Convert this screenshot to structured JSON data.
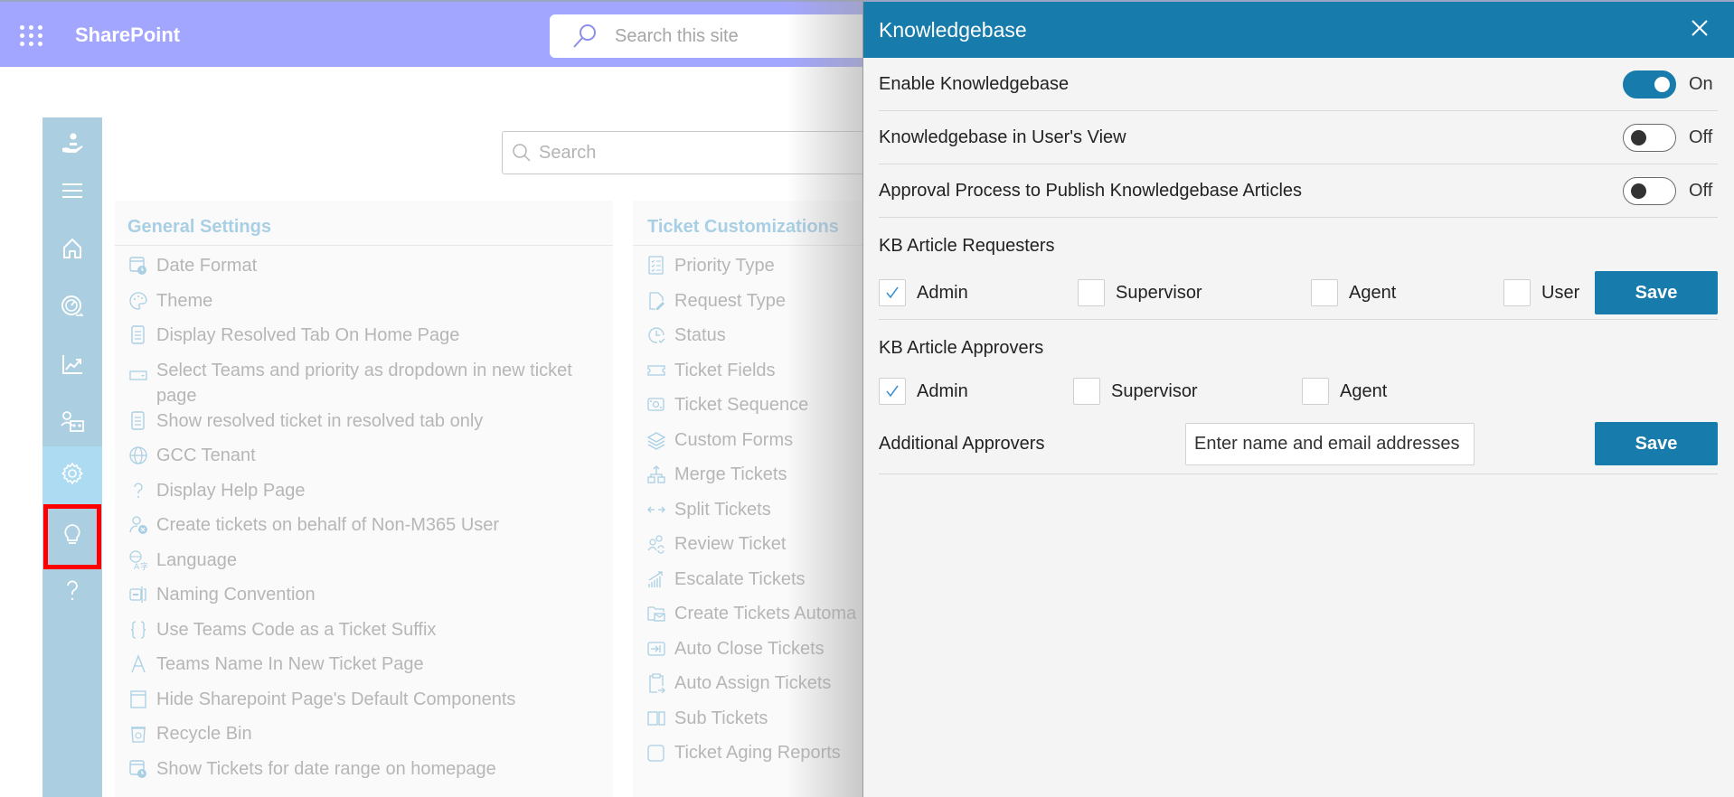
{
  "suitebar": {
    "app_name": "SharePoint",
    "search_placeholder": "Search this site",
    "waffle_icon": "app-launcher-icon",
    "search_icon": "search-icon",
    "color": "#a3a6fe"
  },
  "rail": {
    "color": "#abcfe0",
    "active_color": "#addcf2",
    "items": [
      {
        "icon": "helpdesk-hand-icon"
      },
      {
        "icon": "menu-icon"
      },
      {
        "icon": "home-icon"
      },
      {
        "icon": "dashboard-gauge-icon"
      },
      {
        "icon": "reports-chart-icon"
      },
      {
        "icon": "teams-users-icon"
      },
      {
        "icon": "settings-gear-icon",
        "active": true
      },
      {
        "icon": "knowledgebase-lightbulb-icon",
        "highlighted": true
      },
      {
        "icon": "help-question-icon"
      }
    ]
  },
  "main": {
    "search_placeholder": "Search",
    "general": {
      "title": "General Settings",
      "items": [
        {
          "label": "Date Format",
          "icon": "calendar-clock-icon"
        },
        {
          "label": "Theme",
          "icon": "palette-icon"
        },
        {
          "label": "Display Resolved Tab On Home Page",
          "icon": "document-icon"
        },
        {
          "label": "Select Teams and priority as dropdown in new ticket page",
          "icon": "dropdown-icon"
        },
        {
          "label": "Show resolved ticket in resolved tab only",
          "icon": "document-icon"
        },
        {
          "label": "GCC Tenant",
          "icon": "globe-icon"
        },
        {
          "label": "Display Help Page",
          "icon": "question-icon"
        },
        {
          "label": "Create tickets on behalf of Non-M365 User",
          "icon": "user-blocked-icon"
        },
        {
          "label": "Language",
          "icon": "translate-icon"
        },
        {
          "label": "Naming Convention",
          "icon": "rename-icon"
        },
        {
          "label": "Use Teams Code as a Ticket Suffix",
          "icon": "braces-icon"
        },
        {
          "label": "Teams Name In New Ticket Page",
          "icon": "font-icon"
        },
        {
          "label": "Hide Sharepoint Page's Default Components",
          "icon": "window-icon"
        },
        {
          "label": "Recycle Bin",
          "icon": "recycle-bin-icon"
        },
        {
          "label": "Show Tickets for date range on homepage",
          "icon": "calendar-clock-icon"
        }
      ]
    },
    "ticket": {
      "title": "Ticket Customizations",
      "items": [
        {
          "label": "Priority Type",
          "icon": "checklist-icon"
        },
        {
          "label": "Request Type",
          "icon": "document-edit-icon"
        },
        {
          "label": "Status",
          "icon": "clock-check-icon"
        },
        {
          "label": "Ticket Fields",
          "icon": "ticket-icon"
        },
        {
          "label": "Ticket Sequence",
          "icon": "money-icon"
        },
        {
          "label": "Custom Forms",
          "icon": "layers-icon"
        },
        {
          "label": "Merge Tickets",
          "icon": "merge-icon"
        },
        {
          "label": "Split Tickets",
          "icon": "split-arrows-icon"
        },
        {
          "label": "Review Ticket",
          "icon": "people-sync-icon"
        },
        {
          "label": "Escalate Tickets",
          "icon": "escalate-chart-icon"
        },
        {
          "label": "Create Tickets Automa",
          "icon": "folder-mail-icon"
        },
        {
          "label": "Auto Close Tickets",
          "icon": "close-box-icon"
        },
        {
          "label": "Auto Assign Tickets",
          "icon": "clipboard-arrow-icon"
        },
        {
          "label": "Sub Tickets",
          "icon": "split-panel-icon"
        },
        {
          "label": "Ticket Aging Reports",
          "icon": "square-icon"
        }
      ]
    }
  },
  "panel": {
    "title": "Knowledgebase",
    "close_icon": "close-icon",
    "accent": "#177bab",
    "toggles": [
      {
        "label": "Enable Knowledgebase",
        "on": true,
        "state": "On"
      },
      {
        "label": "Knowledgebase in User's View",
        "on": false,
        "state": "Off"
      },
      {
        "label": "Approval Process to Publish Knowledgebase Articles",
        "on": false,
        "state": "Off"
      }
    ],
    "requesters": {
      "title": "KB Article Requesters",
      "options": [
        {
          "label": "Admin",
          "checked": true
        },
        {
          "label": "Supervisor",
          "checked": false
        },
        {
          "label": "Agent",
          "checked": false
        },
        {
          "label": "User",
          "checked": false
        }
      ],
      "save_label": "Save"
    },
    "approvers": {
      "title": "KB Article Approvers",
      "options": [
        {
          "label": "Admin",
          "checked": true
        },
        {
          "label": "Supervisor",
          "checked": false
        },
        {
          "label": "Agent",
          "checked": false
        }
      ],
      "additional_label": "Additional Approvers",
      "additional_placeholder": "Enter name and email addresses",
      "save_label": "Save"
    }
  }
}
